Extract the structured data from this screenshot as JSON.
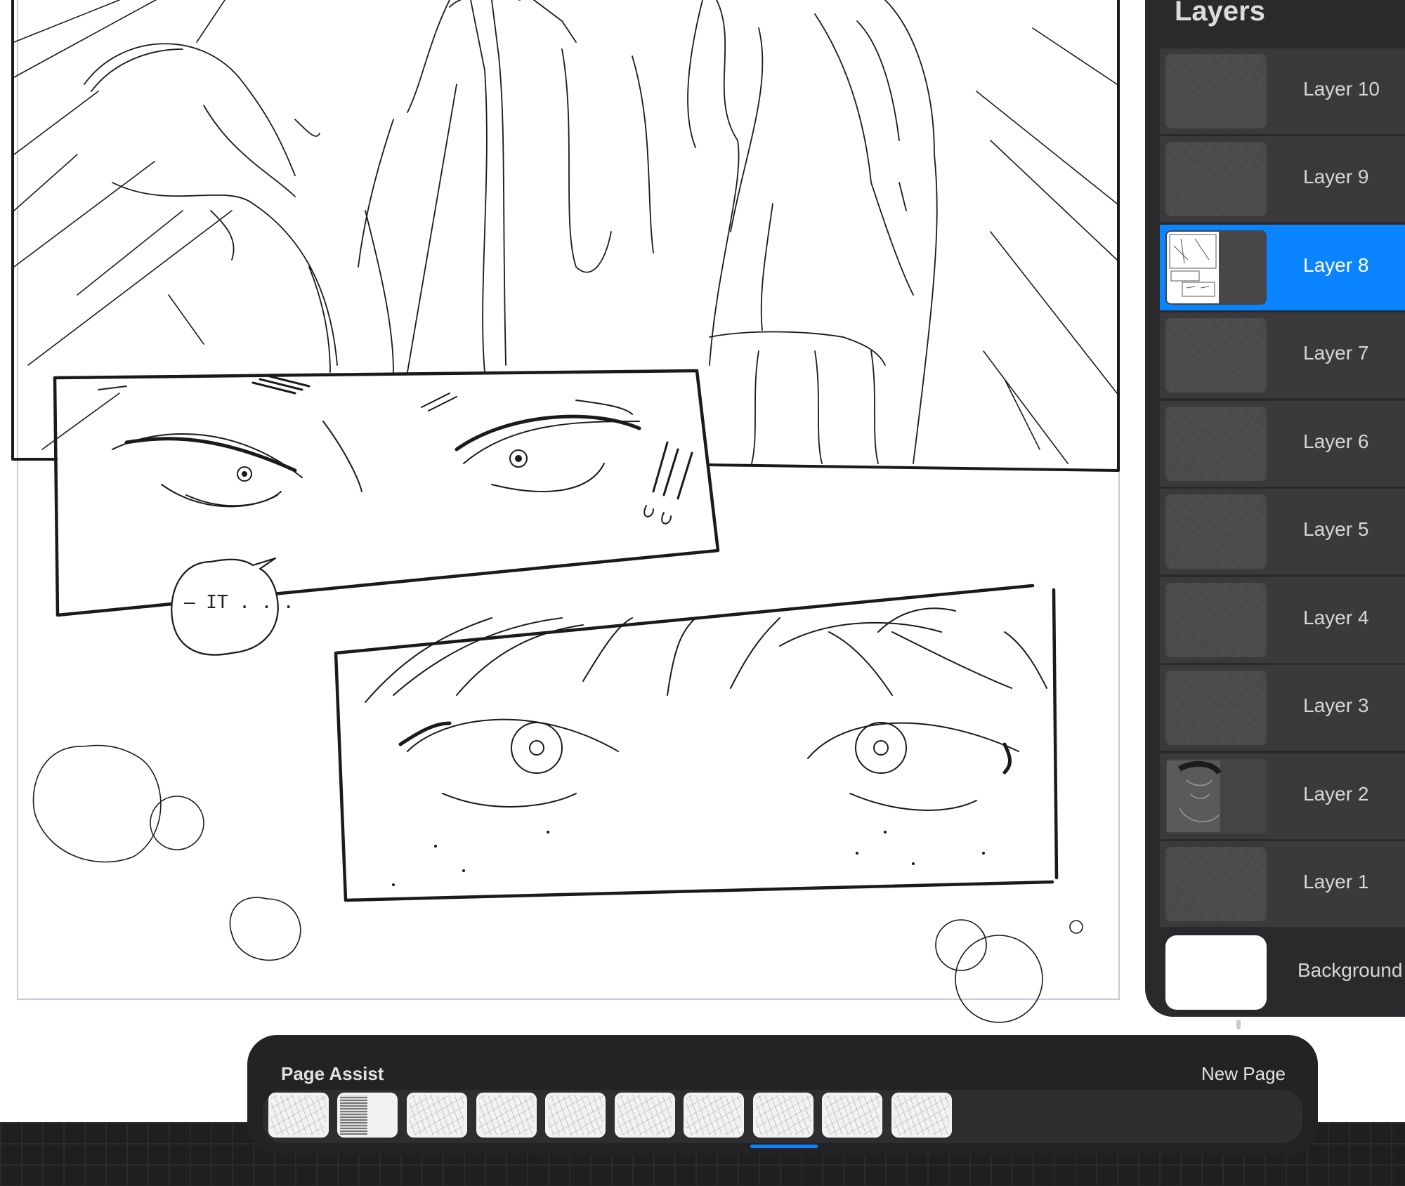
{
  "layers_panel": {
    "title": "Layers",
    "layers": [
      {
        "name": "Layer 10",
        "thumb": "sketch",
        "selected": false
      },
      {
        "name": "Layer 9",
        "thumb": "sketch",
        "selected": false
      },
      {
        "name": "Layer 8",
        "thumb": "page",
        "selected": true
      },
      {
        "name": "Layer 7",
        "thumb": "sketch",
        "selected": false
      },
      {
        "name": "Layer 6",
        "thumb": "sketch",
        "selected": false
      },
      {
        "name": "Layer 5",
        "thumb": "sketch",
        "selected": false
      },
      {
        "name": "Layer 4",
        "thumb": "sketch",
        "selected": false
      },
      {
        "name": "Layer 3",
        "thumb": "sketch",
        "selected": false
      },
      {
        "name": "Layer 2",
        "thumb": "figure",
        "selected": false
      },
      {
        "name": "Layer 1",
        "thumb": "sketch",
        "selected": false
      }
    ],
    "background_label": "Background"
  },
  "canvas": {
    "speech_bubble_text": "— IT . . ."
  },
  "page_assist": {
    "title": "Page Assist",
    "new_page_label": "New Page",
    "page_count": 10,
    "selected_page_index": 7
  },
  "colors": {
    "accent": "#0a84ff",
    "panel_bg": "#2a2a2c",
    "row_bg": "#3a3a3c"
  }
}
